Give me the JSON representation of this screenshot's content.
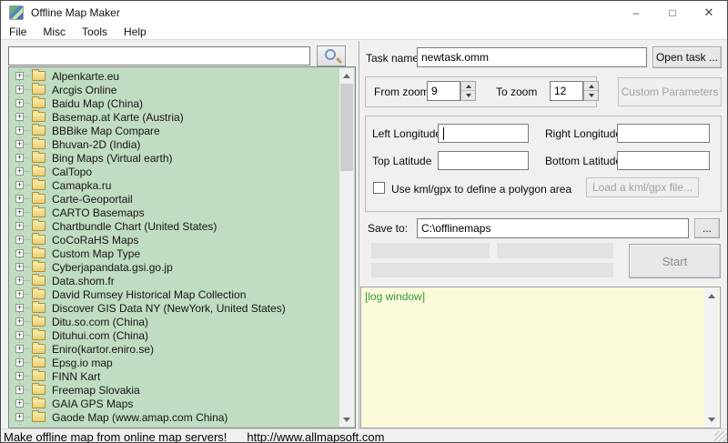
{
  "window": {
    "title": "Offline Map Maker",
    "minimize_glyph": "–",
    "maximize_glyph": "□",
    "close_glyph": "✕"
  },
  "menu": {
    "items": [
      "File",
      "Misc",
      "Tools",
      "Help"
    ]
  },
  "left_panel": {
    "search_input": {
      "value": "",
      "placeholder": ""
    },
    "tree_items": [
      "Alpenkarte.eu",
      "Arcgis Online",
      "Baidu Map (China)",
      "Basemap.at Karte (Austria)",
      "BBBike Map Compare",
      "Bhuvan-2D (India)",
      "Bing Maps (Virtual earth)",
      "CalTopo",
      "Camapka.ru",
      "Carte-Geoportail",
      "CARTO Basemaps",
      "Chartbundle Chart (United States)",
      "CoCoRaHS Maps",
      "Custom Map Type",
      "Cyberjapandata.gsi.go.jp",
      "Data.shom.fr",
      "David Rumsey Historical Map Collection",
      "Discover GIS Data NY (NewYork, United States)",
      "Ditu.so.com (China)",
      "Dituhui.com (China)",
      "Eniro(kartor.eniro.se)",
      "Epsg.io map",
      "FINN Kart",
      "Freemap Slovakia",
      "GAIA GPS Maps",
      "Gaode Map (www.amap.com China)"
    ]
  },
  "right_panel": {
    "task_name_label": "Task name",
    "task_name_value": "newtask.omm",
    "open_task_button": "Open task ...",
    "from_zoom_label": "From zoom",
    "from_zoom_value": "9",
    "to_zoom_label": "To zoom",
    "to_zoom_value": "12",
    "custom_parameters_button": "Custom Parameters",
    "left_longitude_label": "Left Longitude",
    "left_longitude_value": "",
    "right_longitude_label": "Right Longitude",
    "right_longitude_value": "",
    "top_latitude_label": "Top Latitude",
    "top_latitude_value": "",
    "bottom_latitude_label": "Bottom Latitude",
    "bottom_latitude_value": "",
    "kml_checkbox_label": "Use kml/gpx to define a polygon area",
    "kml_checkbox_checked": false,
    "load_kml_button": "Load a kml/gpx file...",
    "save_to_label": "Save to:",
    "save_to_value": "C:\\offlinemaps",
    "browse_button": "...",
    "start_button": "Start",
    "log_window_text": "[log window]"
  },
  "status_bar": {
    "message": "Make offline map from online map servers!",
    "url": "http://www.allmapsoft.com"
  },
  "colors": {
    "tree_background": "#c1ddc1",
    "log_background": "#fbfbdc",
    "log_text": "#339933",
    "folder_icon": "#ecce72"
  }
}
